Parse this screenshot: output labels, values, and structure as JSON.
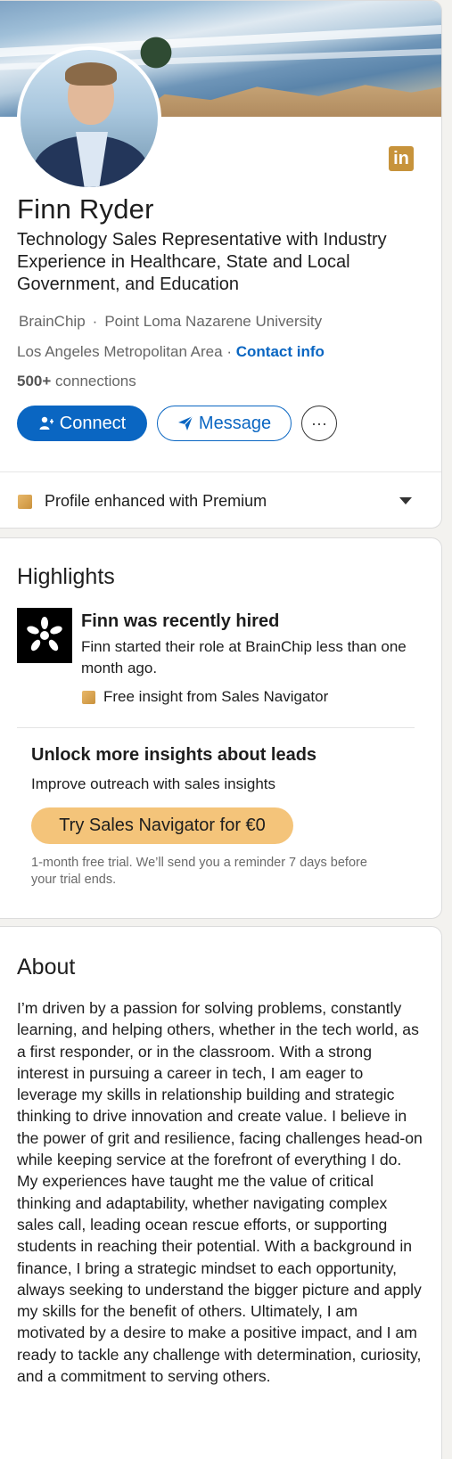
{
  "profile": {
    "name": "Finn Ryder",
    "headline": "Technology Sales Representative with Industry Experience in Healthcare, State and Local Government, and Education",
    "company": "BrainChip",
    "school": "Point Loma Nazarene University",
    "location": "Los Angeles Metropolitan Area",
    "location_separator": "·",
    "contact_info": "Contact info",
    "connections_count": "500+",
    "connections_label": "connections",
    "badge_icon": "linkedin-icon",
    "badge_label": "in"
  },
  "actions": {
    "connect": "Connect",
    "message": "Message",
    "more": "···"
  },
  "premium": {
    "label": "Profile enhanced with Premium"
  },
  "highlights": {
    "title": "Highlights",
    "item_title": "Finn was recently hired",
    "item_body": "Finn started their role at BrainChip less than one month ago.",
    "insight": "Free insight from Sales Navigator",
    "unlock_title": "Unlock more insights about leads",
    "unlock_sub": "Improve outreach with sales insights",
    "cta": "Try Sales Navigator for €0",
    "trial_note": "1-month free trial. We’ll send you a reminder 7 days before your trial ends."
  },
  "about": {
    "title": "About",
    "text": "I’m driven by a passion for solving problems, constantly learning, and helping others, whether in the tech world, as a first responder, or in the classroom. With a strong interest in pursuing a career in tech, I am eager to leverage my skills in relationship building and strategic thinking to drive innovation and create value. I believe in the power of grit and resilience, facing challenges head-on while keeping service at the forefront of everything I do. My experiences have taught me the value of critical thinking and adaptability, whether navigating complex sales call, leading ocean rescue efforts, or supporting students in reaching their potential. With a background in finance, I bring a strategic mindset to each opportunity, always seeking to understand the bigger picture and apply my skills for the benefit of others. Ultimately, I am motivated by a desire to make a positive impact, and I am ready to tackle any challenge with determination, curiosity, and a commitment to serving others."
  },
  "colors": {
    "primary_blue": "#0a66c2",
    "premium_gold": "#c9913c",
    "cta_gold": "#f4c47a"
  }
}
